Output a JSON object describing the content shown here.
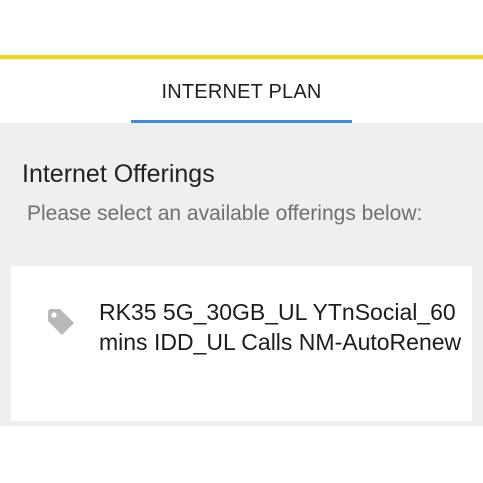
{
  "tabs": {
    "active_label": "INTERNET PLAN"
  },
  "section": {
    "title": "Internet Offerings",
    "subtitle": "Please select an available offerings below:"
  },
  "offering": {
    "icon": "tag-icon",
    "name": "RK35 5G_30GB_UL YTnSocial_60 mins IDD_UL Calls NM-AutoRenew"
  },
  "colors": {
    "accent_yellow": "#f7d417",
    "tab_indicator_blue": "#3f8fdc",
    "content_background": "#efefef"
  }
}
